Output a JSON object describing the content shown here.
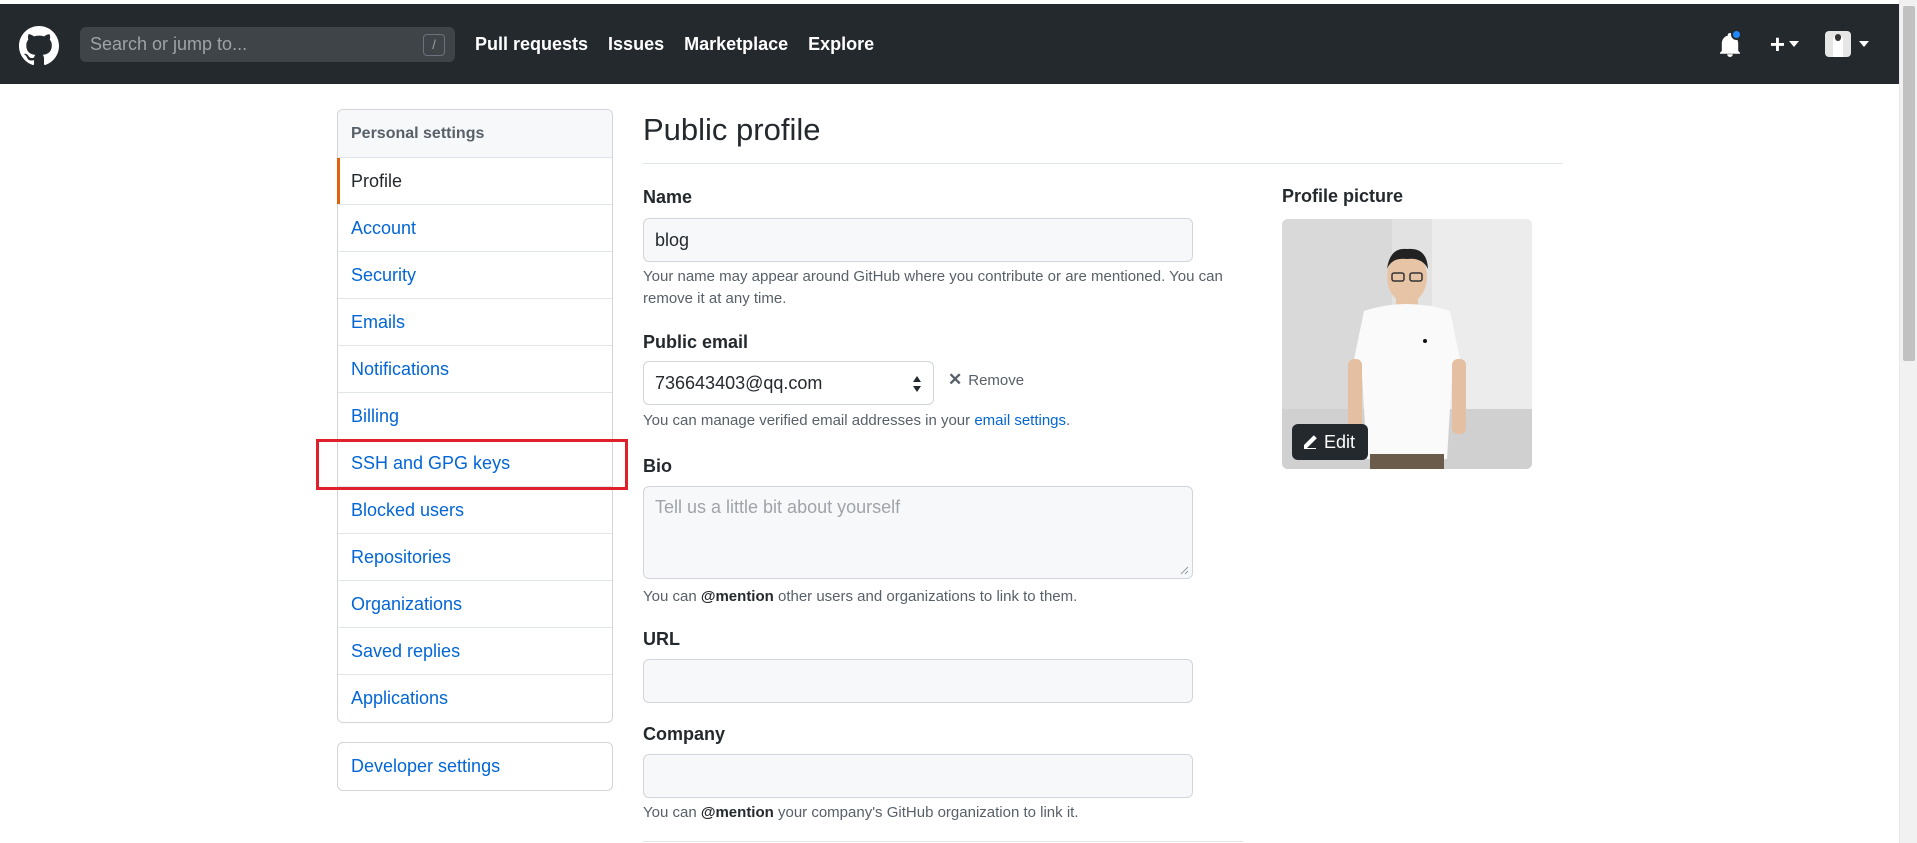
{
  "header": {
    "search_placeholder": "Search or jump to...",
    "search_key": "/",
    "nav": [
      "Pull requests",
      "Issues",
      "Marketplace",
      "Explore"
    ],
    "plus_label": "+"
  },
  "sidebar": {
    "heading": "Personal settings",
    "items": [
      {
        "label": "Profile",
        "selected": true
      },
      {
        "label": "Account"
      },
      {
        "label": "Security"
      },
      {
        "label": "Emails"
      },
      {
        "label": "Notifications"
      },
      {
        "label": "Billing"
      },
      {
        "label": "SSH and GPG keys"
      },
      {
        "label": "Blocked users"
      },
      {
        "label": "Repositories"
      },
      {
        "label": "Organizations"
      },
      {
        "label": "Saved replies"
      },
      {
        "label": "Applications"
      }
    ],
    "developer_settings": "Developer settings"
  },
  "main": {
    "title": "Public profile",
    "name": {
      "label": "Name",
      "value": "blog",
      "note_line1": "Your name may appear around GitHub where you contribute or are mentioned. You can",
      "note_line2": "remove it at any time."
    },
    "email": {
      "label": "Public email",
      "value": "736643403@qq.com",
      "remove": "Remove",
      "note_prefix": "You can manage verified email addresses in your ",
      "note_link": "email settings",
      "note_suffix": "."
    },
    "bio": {
      "label": "Bio",
      "placeholder": "Tell us a little bit about yourself",
      "note_prefix": "You can ",
      "note_mention": "@mention",
      "note_suffix": " other users and organizations to link to them."
    },
    "url": {
      "label": "URL",
      "value": ""
    },
    "company": {
      "label": "Company",
      "value": "",
      "note_prefix": "You can ",
      "note_mention": "@mention",
      "note_suffix": " your company's GitHub organization to link it."
    }
  },
  "profile_picture": {
    "label": "Profile picture",
    "edit": "Edit"
  },
  "colors": {
    "header_bg": "#24292e",
    "link": "#0366d6",
    "selected_accent": "#e36209",
    "highlight_box": "#e0202a",
    "notification_dot": "#2188ff"
  }
}
